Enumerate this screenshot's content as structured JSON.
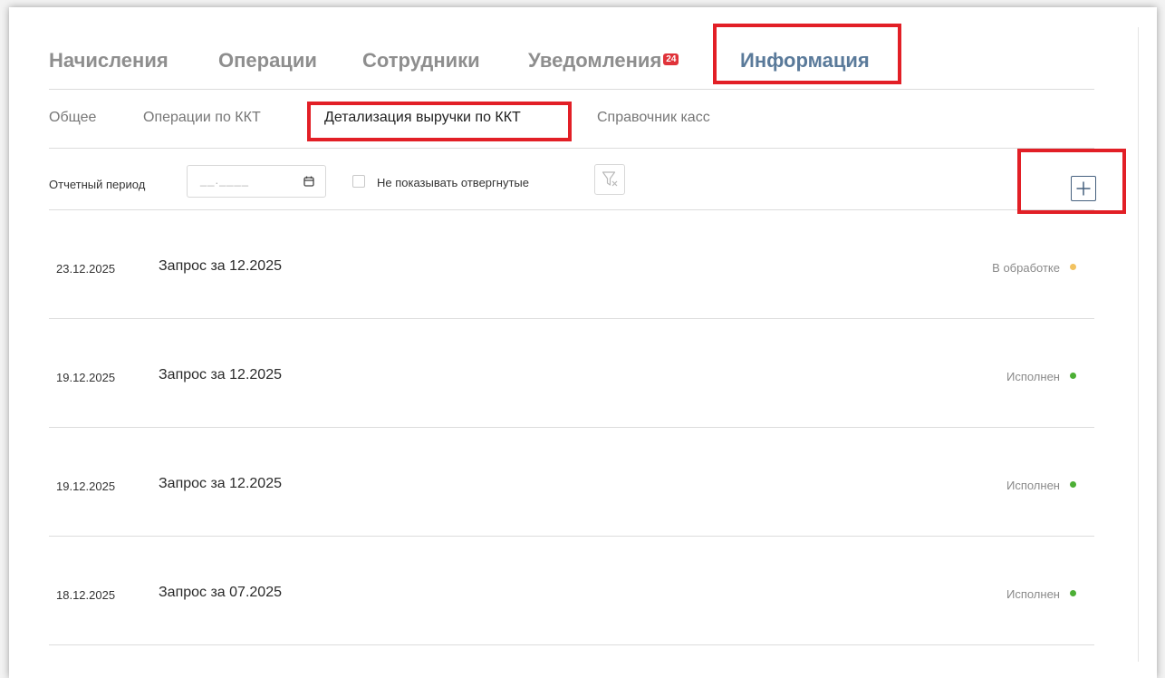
{
  "main_tabs": [
    {
      "label": "Начисления"
    },
    {
      "label": "Операции"
    },
    {
      "label": "Сотрудники"
    },
    {
      "label": "Уведомления",
      "badge": "24"
    },
    {
      "label": "Информация"
    }
  ],
  "sub_tabs": [
    {
      "label": "Общее"
    },
    {
      "label": "Операции по ККТ"
    },
    {
      "label": "Детализация выручки по ККТ"
    },
    {
      "label": "Справочник касс"
    }
  ],
  "filters": {
    "period_label": "Отчетный период",
    "period_mask": "__.____",
    "hide_rejected_label": "Не показывать отвергнутые",
    "hide_rejected_checked": false
  },
  "requests": [
    {
      "date": "23.12.2025",
      "title": "Запрос за 12.2025",
      "status": "В обработке",
      "status_color": "#f2c260"
    },
    {
      "date": "19.12.2025",
      "title": "Запрос за 12.2025",
      "status": "Исполнен",
      "status_color": "#4caf35"
    },
    {
      "date": "19.12.2025",
      "title": "Запрос за 12.2025",
      "status": "Исполнен",
      "status_color": "#4caf35"
    },
    {
      "date": "18.12.2025",
      "title": "Запрос за 07.2025",
      "status": "Исполнен",
      "status_color": "#4caf35"
    }
  ],
  "colors": {
    "highlight": "#e21f26",
    "active_tab": "#5a7a9a",
    "add_button": "#45607e"
  }
}
